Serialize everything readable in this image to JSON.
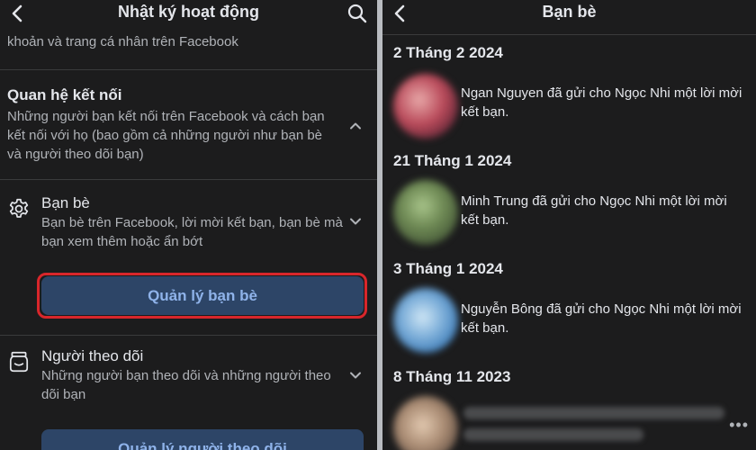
{
  "left": {
    "header": {
      "title": "Nhật ký hoạt động",
      "back_icon": "chevron-left-icon",
      "search_icon": "search-icon"
    },
    "clipped_text": "khoản và trang cá nhân trên Facebook",
    "section": {
      "title": "Quan hệ kết nối",
      "description": "Những người bạn kết nối trên Facebook và cách bạn kết nối với họ (bao gồm cả những người như bạn bè và người theo dõi bạn)"
    },
    "friends": {
      "icon": "gear-icon",
      "title": "Bạn bè",
      "description": "Bạn bè trên Facebook, lời mời kết bạn, bạn bè mà bạn xem thêm hoặc ẩn bớt",
      "button": "Quản lý bạn bè"
    },
    "followers": {
      "icon": "jar-icon",
      "title": "Người theo dõi",
      "description": "Những người bạn theo dõi và những người theo dõi bạn",
      "button": "Quản lý người theo dõi"
    }
  },
  "right": {
    "header": {
      "title": "Bạn bè",
      "back_icon": "chevron-left-icon"
    },
    "entries": [
      {
        "date": "2 Tháng 2 2024",
        "text": "Ngan Nguyen đã gửi cho Ngọc Nhi một lời mời kết bạn."
      },
      {
        "date": "21 Tháng 1 2024",
        "text": "Minh Trung đã gửi cho Ngọc Nhi một lời mời kết bạn."
      },
      {
        "date": "3 Tháng 1 2024",
        "text": "Nguyễn Bông đã gửi cho Ngọc Nhi một lời mời kết bạn."
      },
      {
        "date": "8 Tháng 11 2023",
        "text": ""
      }
    ],
    "more": "•••"
  },
  "colors": {
    "background": "#1c1c1d",
    "button_bg": "#2d4567",
    "button_text": "#8fb3ea",
    "highlight": "#d9262b"
  }
}
